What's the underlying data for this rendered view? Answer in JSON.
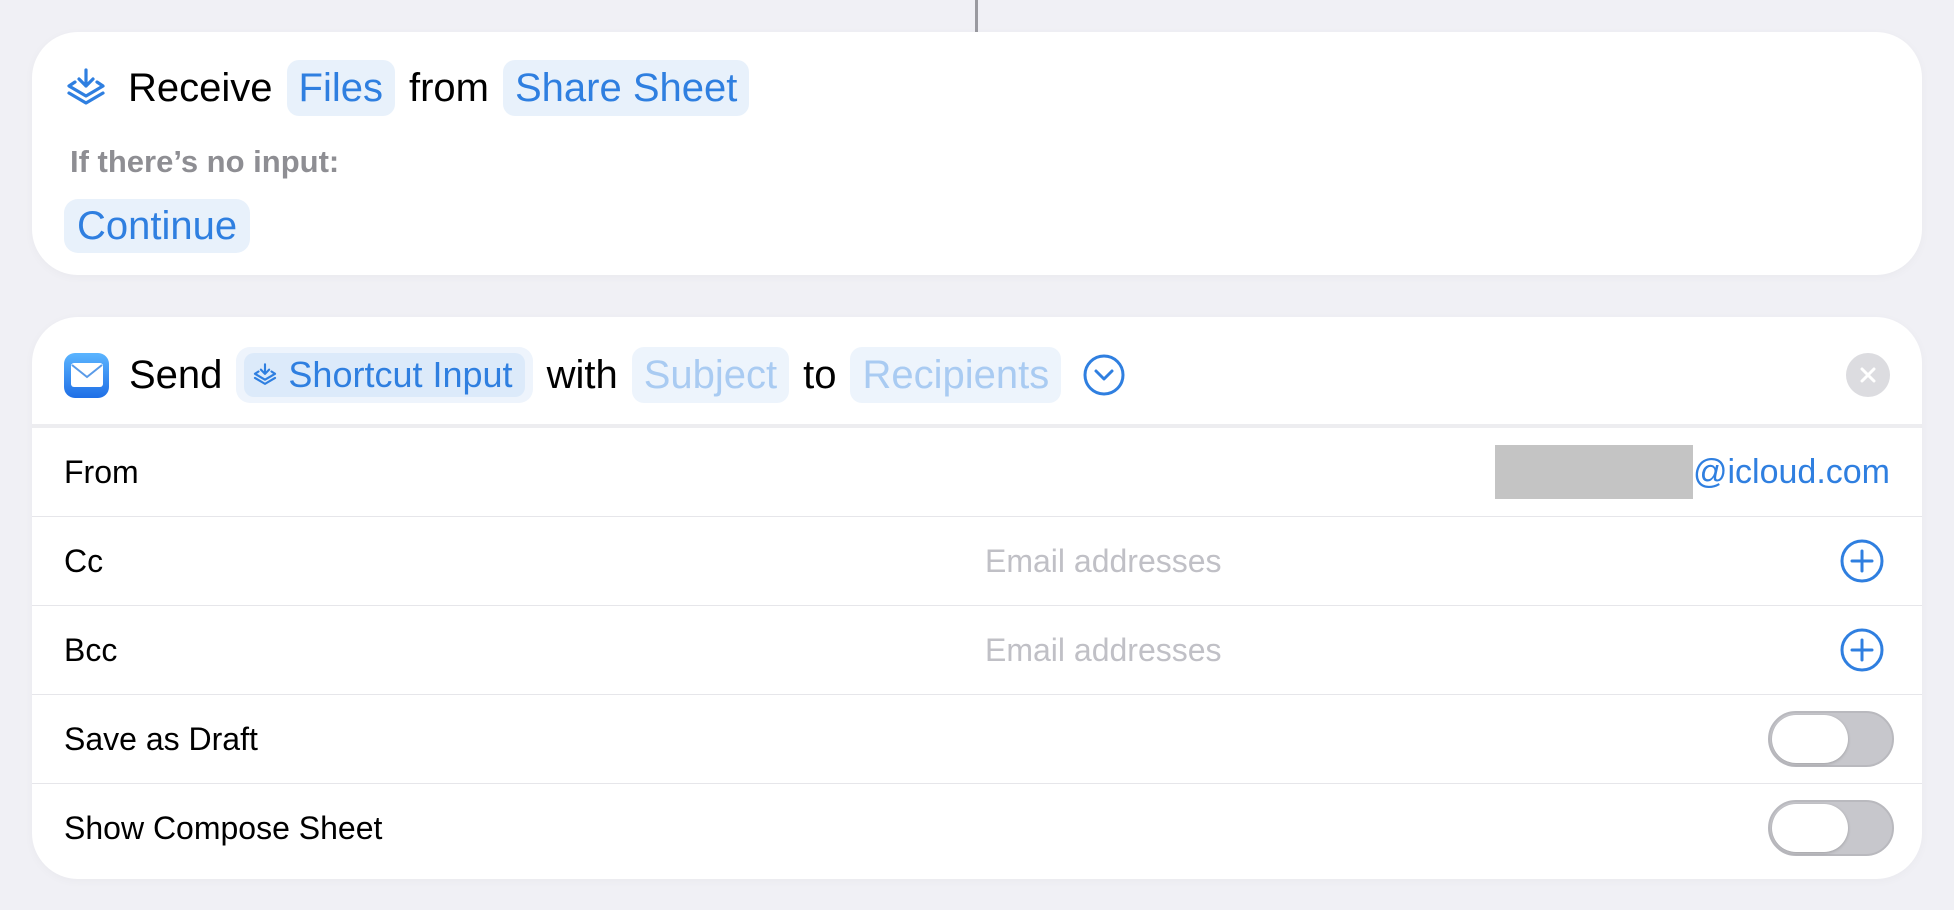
{
  "receive_action": {
    "verb": "Receive",
    "type_token": "Files",
    "connector": "from",
    "source_token": "Share Sheet",
    "no_input_label": "If there’s no input:",
    "no_input_action": "Continue"
  },
  "send_action": {
    "verb": "Send",
    "input_token": "Shortcut Input",
    "with_word": "with",
    "subject_placeholder": "Subject",
    "to_word": "to",
    "recipients_placeholder": "Recipients",
    "rows": {
      "from": {
        "label": "From",
        "value_suffix": "@icloud.com"
      },
      "cc": {
        "label": "Cc",
        "placeholder": "Email addresses"
      },
      "bcc": {
        "label": "Bcc",
        "placeholder": "Email addresses"
      },
      "save_as_draft": {
        "label": "Save as Draft",
        "enabled": false
      },
      "show_compose_sheet": {
        "label": "Show Compose Sheet",
        "enabled": false
      }
    }
  },
  "colors": {
    "accent": "#2f7fe0",
    "token_bg": "#e8f1fb",
    "secondary_text": "#8e8e93",
    "placeholder_text": "#c0c0c6",
    "toggle_off": "#c7c7cc"
  },
  "icons": {
    "receive": "share-sheet-receive-icon",
    "mail": "mail-app-icon",
    "expand": "chevron-down-circle-icon",
    "close": "xmark-circle-icon",
    "add": "plus-circle-icon"
  }
}
